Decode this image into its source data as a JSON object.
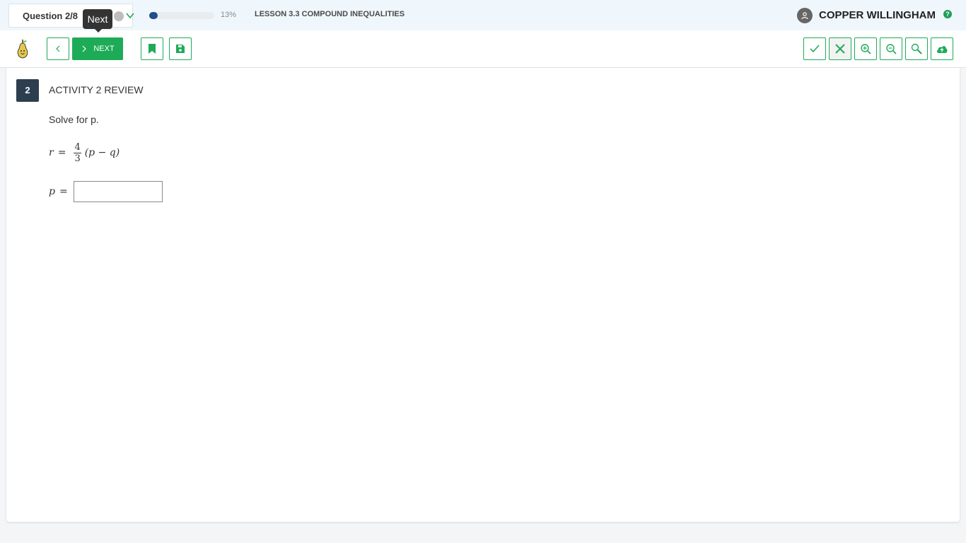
{
  "header": {
    "question_label": "Question 2/8",
    "tooltip": "Next",
    "progress_percent": 13,
    "progress_text": "13%",
    "lesson_title": "LESSON 3.3 COMPOUND INEQUALITIES",
    "user_name": "COPPER WILLINGHAM",
    "help_glyph": "?"
  },
  "toolbar": {
    "next_label": "NEXT",
    "icons": [
      "chevron-left-icon",
      "chevron-right-icon",
      "bookmark-icon",
      "save-icon",
      "check-icon",
      "close-icon",
      "zoom-in-icon",
      "zoom-out-icon",
      "search-icon",
      "cloud-upload-icon"
    ]
  },
  "question": {
    "number": "2",
    "title": "ACTIVITY 2 REVIEW",
    "prompt": "Solve for p.",
    "equation": {
      "lhs": "r",
      "eq": "=",
      "frac_num": "4",
      "frac_den": "3",
      "rest": "(p − q)"
    },
    "answer_var": "p",
    "answer_eq": "=",
    "answer_value": ""
  },
  "colors": {
    "accent": "#1eab58",
    "progress": "#1f4e8c",
    "qbadge": "#2d3e4f"
  }
}
